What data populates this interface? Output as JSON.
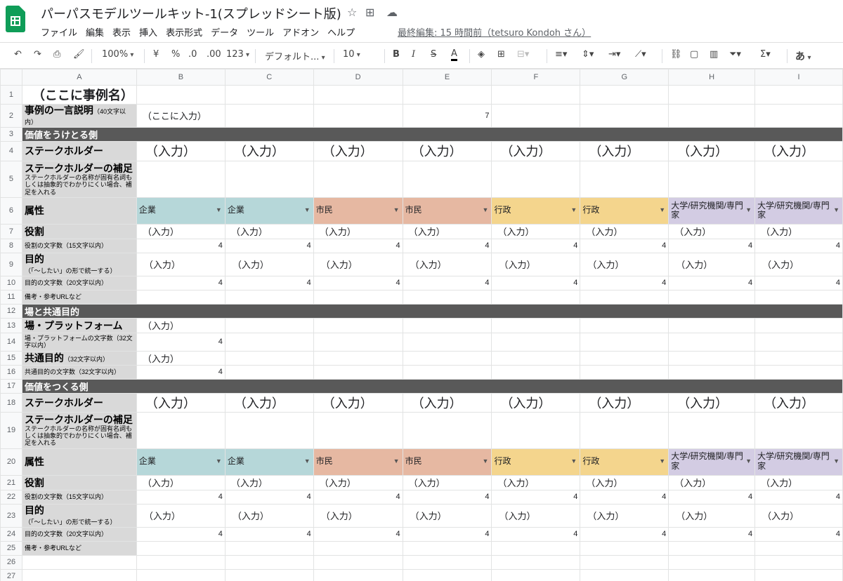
{
  "app": {
    "title": "パーパスモデルツールキット-1(スプレッドシート版)",
    "last_edit": "最終編集: 15 時間前（tetsuro Kondoh さん）",
    "menu": [
      "ファイル",
      "編集",
      "表示",
      "挿入",
      "表示形式",
      "データ",
      "ツール",
      "アドオン",
      "ヘルプ"
    ]
  },
  "toolbar": {
    "zoom": "100%",
    "currency": "¥",
    "percent": "%",
    "dec_less": ".0",
    "dec_more": ".00",
    "format_more": "123",
    "font": "デフォルト...",
    "font_size": "10",
    "input_mode": "あ"
  },
  "columns": [
    "A",
    "B",
    "C",
    "D",
    "E",
    "F",
    "G",
    "H",
    "I"
  ],
  "rows": [
    {
      "n": "1",
      "a": "（ここに事例名）"
    },
    {
      "n": "2",
      "a": "事例の一言説明",
      "a_sub": "（40文字以内）",
      "b": "（ここに入力）",
      "e": "7"
    },
    {
      "n": "3",
      "a": "価値をうけとる側"
    },
    {
      "n": "4",
      "a": "ステークホルダー",
      "input": "（入力）"
    },
    {
      "n": "5",
      "a": "ステークホルダーの補足",
      "a_note": "ステークホルダーの名称が固有名詞もしくは抽象的でわかりにくい場合、補足を入れる"
    },
    {
      "n": "6",
      "a": "属性"
    },
    {
      "n": "7",
      "a": "役割",
      "input": "（入力）"
    },
    {
      "n": "8",
      "a": "役割の文字数（15文字以内）",
      "count": "4"
    },
    {
      "n": "9",
      "a": "目的",
      "a_sub": "（「〜したい」の形で統一する）",
      "input": "（入力）"
    },
    {
      "n": "10",
      "a": "目的の文字数（20文字以内）",
      "count": "4"
    },
    {
      "n": "11",
      "a": "備考・参考URLなど"
    },
    {
      "n": "12",
      "a": "場と共通目的"
    },
    {
      "n": "13",
      "a": "場・プラットフォーム",
      "b": "（入力）"
    },
    {
      "n": "14",
      "a": "場・プラットフォームの文字数（32文字以内）",
      "b": "4"
    },
    {
      "n": "15",
      "a": "共通目的",
      "a_sub": "（32文字以内）",
      "b": "（入力）"
    },
    {
      "n": "16",
      "a": "共通目的の文字数（32文字以内）",
      "b": "4"
    },
    {
      "n": "17",
      "a": "価値をつくる側"
    },
    {
      "n": "18",
      "a": "ステークホルダー",
      "input": "（入力）"
    },
    {
      "n": "19",
      "a": "ステークホルダーの補足",
      "a_note": "ステークホルダーの名称が固有名詞もしくは抽象的でわかりにくい場合、補足を入れる"
    },
    {
      "n": "20",
      "a": "属性"
    },
    {
      "n": "21",
      "a": "役割",
      "input": "（入力）"
    },
    {
      "n": "22",
      "a": "役割の文字数（15文字以内）",
      "count": "4"
    },
    {
      "n": "23",
      "a": "目的",
      "a_sub": "（「〜したい」の形で統一する）",
      "input": "（入力）"
    },
    {
      "n": "24",
      "a": "目的の文字数（20文字以内）",
      "count": "4"
    },
    {
      "n": "25",
      "a": "備考・参考URLなど"
    },
    {
      "n": "26"
    },
    {
      "n": "27"
    }
  ],
  "categories": [
    {
      "label": "企業",
      "color": "#b6d7d9"
    },
    {
      "label": "企業",
      "color": "#b6d7d9"
    },
    {
      "label": "市民",
      "color": "#e6b8a2"
    },
    {
      "label": "市民",
      "color": "#e6b8a2"
    },
    {
      "label": "行政",
      "color": "#f4d58d"
    },
    {
      "label": "行政",
      "color": "#f4d58d"
    },
    {
      "label": "大学/研究機関/専門家",
      "color": "#d3cce3"
    },
    {
      "label": "大学/研究機関/専門家",
      "color": "#d3cce3"
    }
  ],
  "colors": {
    "section": "#595959",
    "label_col": "#d9d9d9",
    "sheets_green": "#0f9d58"
  }
}
